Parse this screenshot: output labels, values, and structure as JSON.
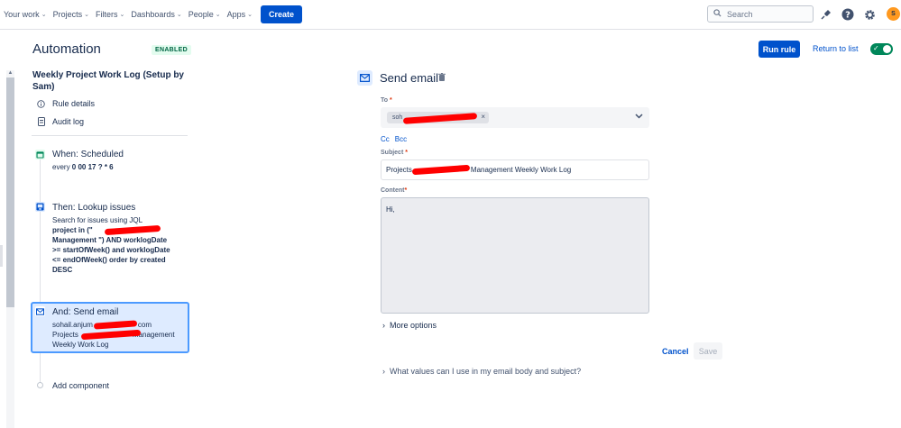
{
  "nav": {
    "items": [
      {
        "label": "Your work"
      },
      {
        "label": "Projects"
      },
      {
        "label": "Filters"
      },
      {
        "label": "Dashboards"
      },
      {
        "label": "People"
      },
      {
        "label": "Apps"
      }
    ],
    "create_label": "Create",
    "search_placeholder": "Search",
    "avatar_initial": "S"
  },
  "header": {
    "title": "Automation",
    "status_badge": "ENABLED",
    "run_label": "Run rule",
    "return_label": "Return to list",
    "rule_enabled": true
  },
  "sidebar": {
    "rule_name": "Weekly Project Work Log (Setup by Sam)",
    "links": [
      {
        "label": "Rule details",
        "icon": "info-icon"
      },
      {
        "label": "Audit log",
        "icon": "document-icon"
      }
    ],
    "components": [
      {
        "title": "When: Scheduled",
        "icon": "calendar-icon",
        "line1_prefix": "every ",
        "line1_bold": "0 00 17 ? * 6"
      },
      {
        "title": "Then: Lookup issues",
        "icon": "jql-icon",
        "line1": "Search for issues using JQL",
        "jql_lines": [
          "project in (\"",
          "Management \") AND worklogDate",
          ">= startOfWeek() and worklogDate",
          "<= endOfWeek() order by created",
          "DESC"
        ]
      },
      {
        "title": "And: Send email",
        "icon": "mail-icon",
        "lines": [
          "sohail.anjum",
          "com",
          "Projects",
          "Management",
          "Weekly Work Log"
        ]
      }
    ],
    "add_component_label": "Add component"
  },
  "form": {
    "title": "Send email",
    "to_label": "To",
    "to_chip": "soh",
    "cc_label": "Cc",
    "bcc_label": "Bcc",
    "subject_label": "Subject",
    "subject_prefix": "Projects",
    "subject_suffix": "Management Weekly Work Log",
    "content_label": "Content",
    "content_value": "Hi,",
    "more_options_label": "More options",
    "cancel_label": "Cancel",
    "save_label": "Save",
    "values_help_label": "What values can I use in my email body and subject?"
  }
}
